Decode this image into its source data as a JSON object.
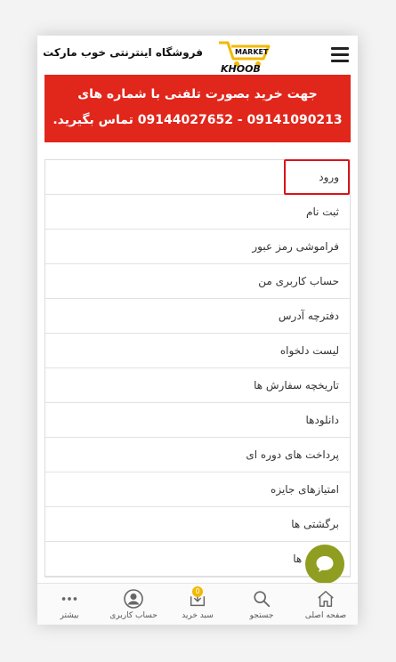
{
  "header": {
    "brand_text": "فروشگاه اینترنتی خوب مارکت",
    "logo_top": "MARKET",
    "logo_bottom": "KHOOB"
  },
  "banner": {
    "text": "جهت خرید بصورت تلفنی با شماره های 09141090213 - 09144027652 تماس بگیرید.",
    "color": "#e1261c"
  },
  "menu": {
    "items": [
      {
        "label": "ورود"
      },
      {
        "label": "ثبت نام"
      },
      {
        "label": "فراموشی رمز عبور"
      },
      {
        "label": "حساب کاربری من"
      },
      {
        "label": "دفترچه آدرس"
      },
      {
        "label": "لیست دلخواه"
      },
      {
        "label": "تاریخچه سفارش ها"
      },
      {
        "label": "دانلودها"
      },
      {
        "label": "پرداخت های دوره ای"
      },
      {
        "label": "امتیازهای جایزه"
      },
      {
        "label": "برگشتی ها"
      },
      {
        "label": "تراکنش ها"
      }
    ]
  },
  "bottom_nav": {
    "home": "صفحه اصلی",
    "search": "جستجو",
    "cart": "سبد خرید",
    "cart_count": "0",
    "account": "حساب کاربری",
    "more": "بیشتر"
  },
  "colors": {
    "accent_red": "#d8141a",
    "chat": "#8f9e21",
    "badge": "#f2b900"
  }
}
